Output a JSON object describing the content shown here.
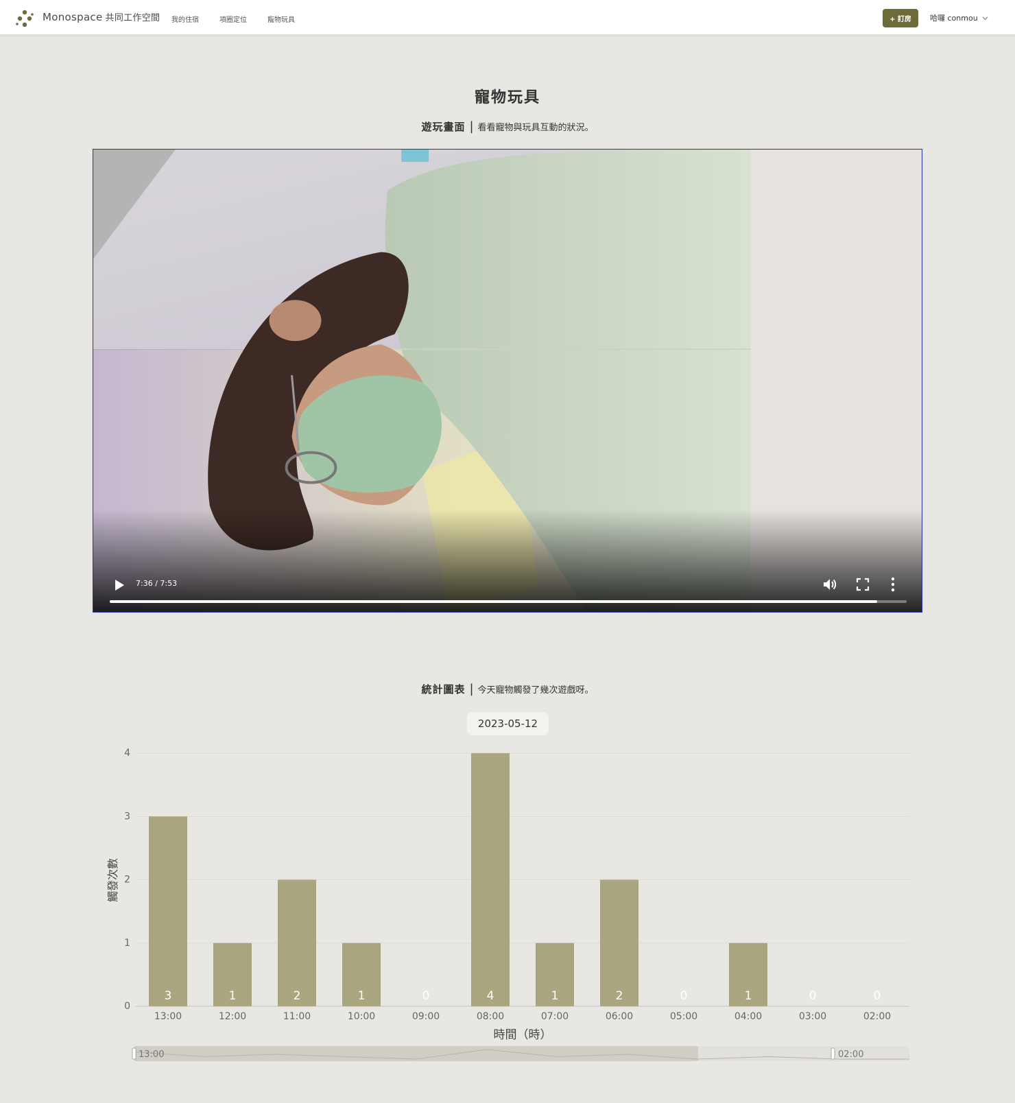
{
  "navbar": {
    "brand": "Monospace",
    "brand_sub": "共同工作空間",
    "links": [
      "我的住宿",
      "項圈定位",
      "寵物玩具"
    ],
    "order_button": "+ 訂房",
    "user_greeting": "哈囉 conmou"
  },
  "page": {
    "title": "寵物玩具"
  },
  "video_section": {
    "heading": "遊玩畫面",
    "separator": "|",
    "description": "看看寵物與玩具互動的狀況。"
  },
  "video": {
    "time_display": "7:36 / 7:53",
    "progress": 0.963
  },
  "chart_section": {
    "heading": "統計圖表",
    "separator": "|",
    "description": "今天寵物觸發了幾次遊戲呀。"
  },
  "date": "2023-05-12",
  "colors": {
    "accent": "#6d6b3a",
    "bar": "#a9a680",
    "background": "#e9e7e3"
  },
  "chart_data": {
    "type": "bar",
    "categories": [
      "13:00",
      "12:00",
      "11:00",
      "10:00",
      "09:00",
      "08:00",
      "07:00",
      "06:00",
      "05:00",
      "04:00",
      "03:00",
      "02:00"
    ],
    "values": [
      3,
      1,
      2,
      1,
      0,
      4,
      1,
      2,
      0,
      1,
      0,
      0
    ],
    "xlabel": "時間（時）",
    "ylabel": "觸發次數",
    "ylim": [
      0,
      4
    ],
    "yticks": [
      0,
      1,
      2,
      3,
      4
    ],
    "grid": true,
    "data_labels": true,
    "zoom_slider": {
      "start_label": "13:00",
      "end_label": "02:00"
    }
  }
}
